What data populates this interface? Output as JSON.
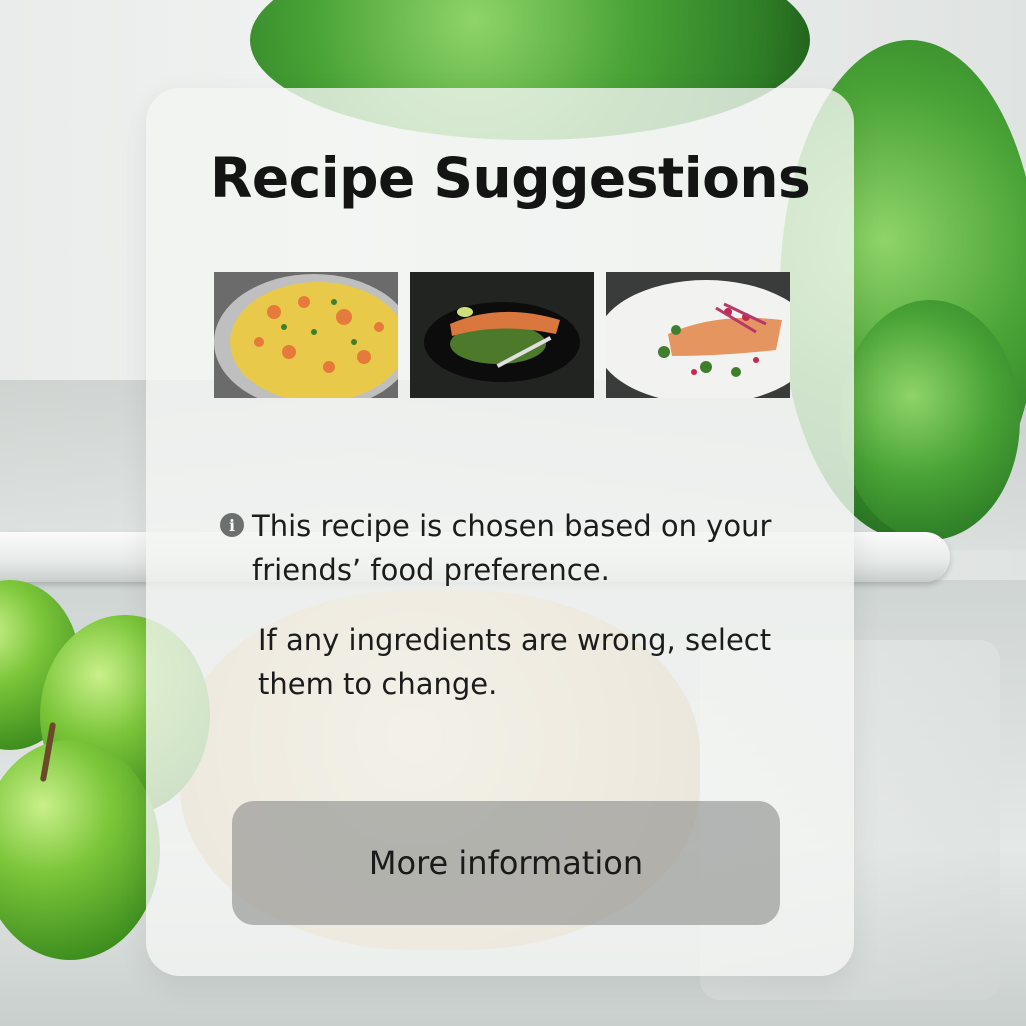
{
  "panel": {
    "title": "Recipe Suggestions",
    "recipes": [
      {
        "icon": "scrambled-eggs-salmon-dish",
        "selected": true
      },
      {
        "icon": "salmon-on-black-plate",
        "selected": false
      },
      {
        "icon": "salmon-on-white-plate",
        "selected": false
      }
    ],
    "info_icon": "info-icon",
    "info_text": "This recipe is chosen based on your friends’ food preference.",
    "change_text": "If any ingredients are wrong, select them to change.",
    "button_label": "More information"
  },
  "colors": {
    "selection_outline": "#3d67c0",
    "panel_background": "#f3f5f3",
    "button_background": "#8c8e8d"
  }
}
